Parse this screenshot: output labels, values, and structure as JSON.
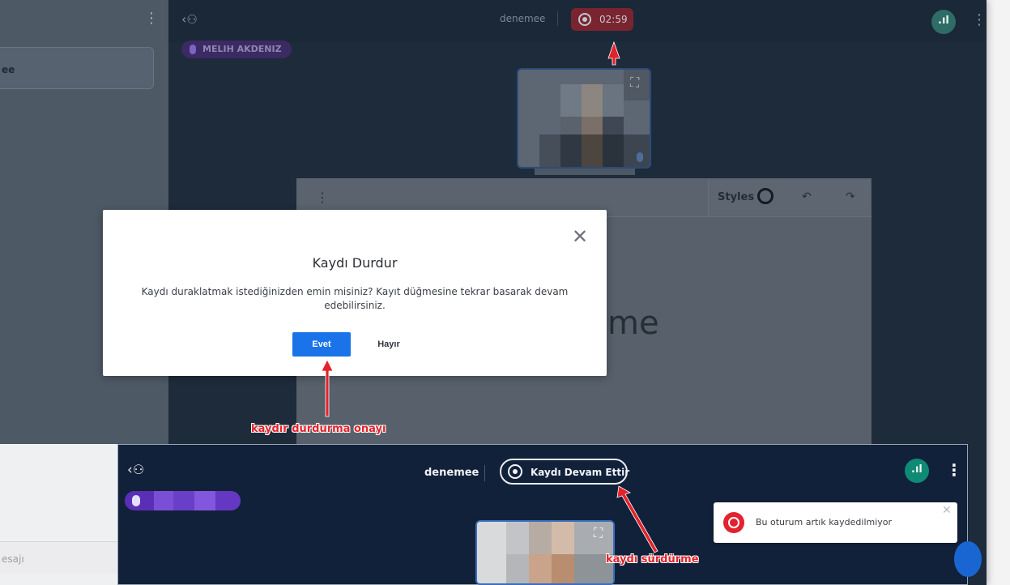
{
  "top": {
    "room_name": "denemee",
    "rec_time": "02:59",
    "participant_name": "MELIH AKDENIZ",
    "chat_item": "ee",
    "whiteboard": {
      "styles_label": "Styles",
      "canvas_text": "me"
    }
  },
  "modal": {
    "title": "Kaydı Durdur",
    "body": "Kaydı duraklatmak istediğinizden emin misiniz? Kayıt düğmesine tekrar basarak devam edebilirsiniz.",
    "yes_label": "Evet",
    "no_label": "Hayır"
  },
  "annotations": {
    "confirm": "kaydır durdurma onayı",
    "resume": "kaydı sürdürme"
  },
  "chat_input": {
    "placeholder_fragment": "esajı"
  },
  "bottom": {
    "room_name": "denemee",
    "resume_label": "Kaydı Devam Ettir",
    "toast_text": "Bu oturum artık kaydedilmiyor"
  },
  "colors": {
    "accent": "#1a73e8",
    "record_red": "#e3222f",
    "annotation_red": "#e2232b",
    "signal_green": "#0f8a74",
    "bg_dark": "#12213a"
  },
  "icons": {
    "user": "user-icon",
    "record": "record-icon",
    "signal": "signal-icon",
    "more": "more-icon",
    "mic": "mic-icon",
    "close": "close-icon",
    "undo": "undo-icon",
    "redo": "redo-icon"
  }
}
